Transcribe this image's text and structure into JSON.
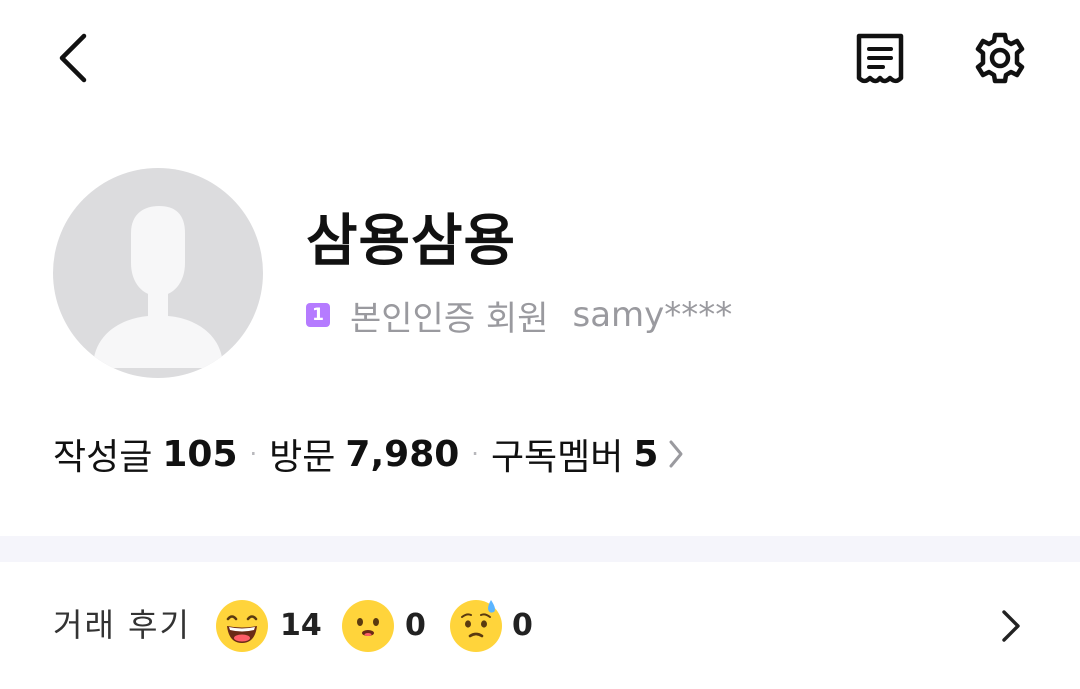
{
  "topbar": {
    "back_icon": "chevron-left-icon",
    "receipt_icon": "receipt-icon",
    "settings_icon": "gear-icon"
  },
  "profile": {
    "nickname": "삼용삼용",
    "level_badge": "1",
    "verified_label": "본인인증 회원",
    "user_id": "samy****"
  },
  "stats": {
    "posts_label": "작성글",
    "posts_value": "105",
    "visits_label": "방문",
    "visits_value": "7,980",
    "subscribers_label": "구독멤버",
    "subscribers_value": "5",
    "separator": "·"
  },
  "reviews": {
    "label": "거래 후기",
    "good_count": "14",
    "neutral_count": "0",
    "bad_count": "0"
  },
  "colors": {
    "badge": "#b57bff",
    "divider": "#f5f5fb",
    "avatar_bg": "#dcdcde",
    "emoji_yellow": "#ffd43b"
  }
}
